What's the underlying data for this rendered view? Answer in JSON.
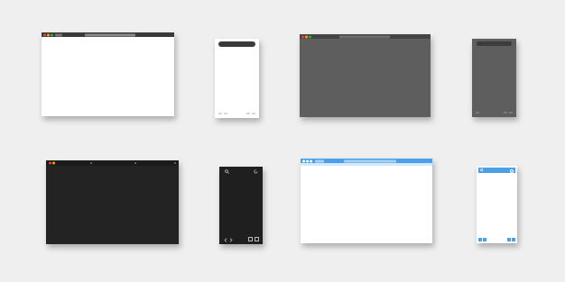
{
  "mockups": [
    {
      "id": "browser-light",
      "kind": "desktop-browser",
      "frame": "#ffffff",
      "bar": "#3a3a3a",
      "address_bar": "#8a8a8a"
    },
    {
      "id": "phone-light",
      "kind": "mobile",
      "frame": "#ffffff",
      "bar": "#3a3a3a"
    },
    {
      "id": "browser-gray",
      "kind": "desktop-browser",
      "frame": "#5e5e5e",
      "bar": "#444444",
      "address_bar": "#6e6e6e"
    },
    {
      "id": "phone-gray",
      "kind": "mobile",
      "frame": "#5e5e5e",
      "bar": "#3c3c3c"
    },
    {
      "id": "browser-black",
      "kind": "desktop-browser",
      "frame": "#232323",
      "bar": "#1b1b1b"
    },
    {
      "id": "phone-black",
      "kind": "mobile",
      "frame": "#1f1f1f"
    },
    {
      "id": "browser-blue",
      "kind": "desktop-browser",
      "frame": "#ffffff",
      "bar": "#4ba0e8",
      "address_bar": "#a9d1f4"
    },
    {
      "id": "phone-blue",
      "kind": "mobile",
      "frame": "#ffffff",
      "bar": "#4ba0e8"
    }
  ],
  "window_dots": [
    "#e0443a",
    "#f2a320",
    "#3aa845"
  ],
  "icons": [
    "search-icon",
    "refresh-icon",
    "back-icon",
    "forward-icon",
    "tabs-icon",
    "home-icon"
  ]
}
